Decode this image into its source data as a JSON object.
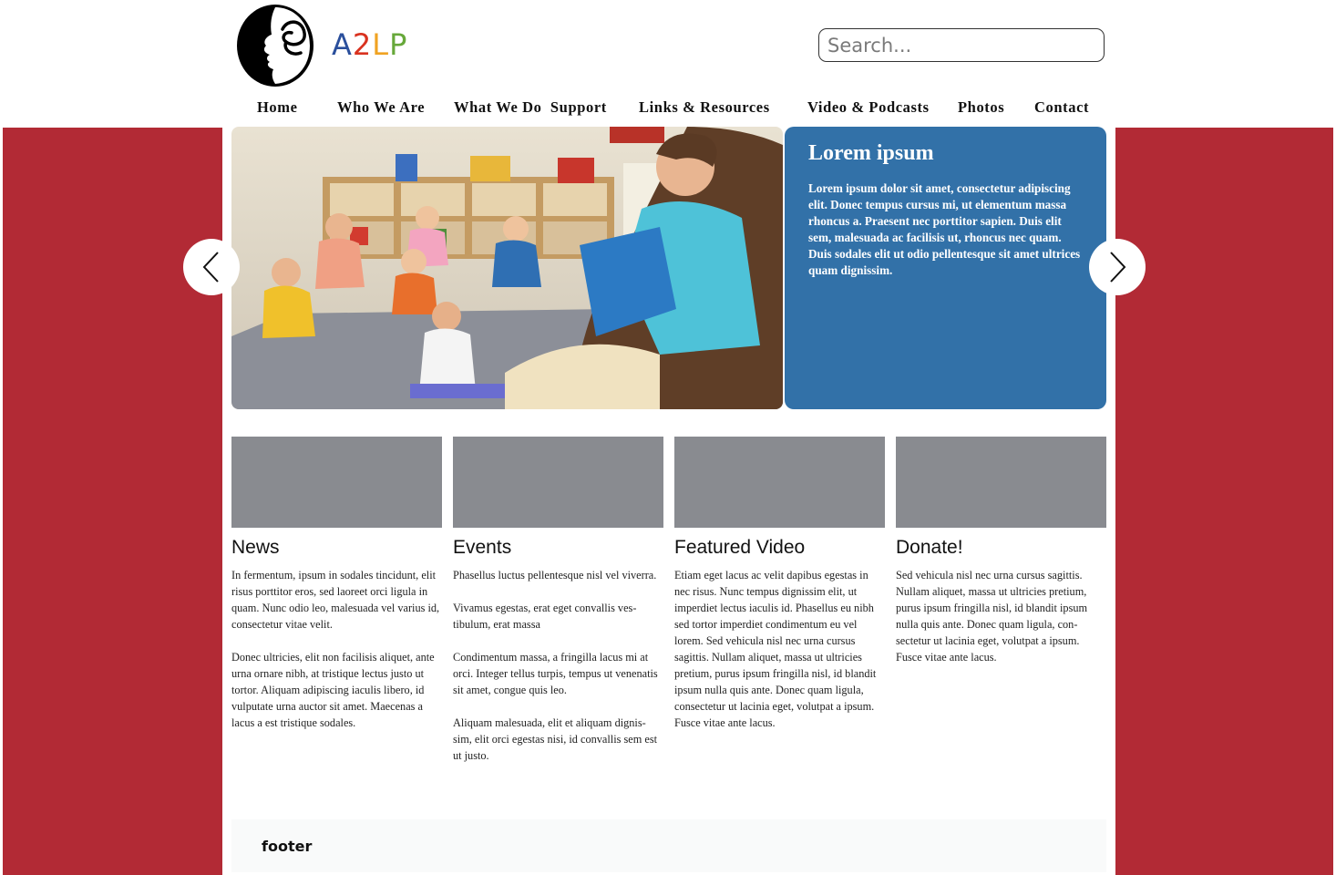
{
  "header": {
    "brand": {
      "letters": [
        "A",
        "2",
        "L",
        "P"
      ],
      "colors": [
        "#2a4f9c",
        "#d9321f",
        "#f0a322",
        "#67a83a"
      ]
    },
    "search": {
      "placeholder": "Search..."
    }
  },
  "nav": {
    "items": [
      {
        "label": "Home"
      },
      {
        "label": "Who We Are"
      },
      {
        "label": "What We Do  Support"
      },
      {
        "label": "Links & Resources"
      },
      {
        "label": "Video & Podcasts"
      },
      {
        "label": "Photos"
      },
      {
        "label": "Contact"
      }
    ]
  },
  "hero": {
    "title": "Lorem ipsum",
    "text": "Lorem ipsum dolor sit amet, consectetur adipiscing elit. Donec tempus cursus mi, ut elementum massa rhoncus a. Praesent nec porttitor sapien. Duis elit sem, malesuada ac facilisis ut, rhoncus nec quam. Duis sodales elit ut odio pellentesque sit amet ultrices quam dignissim.",
    "accent": "#3271a8"
  },
  "columns": [
    {
      "title": "News",
      "paragraphs": [
        "In fermentum, ipsum in sodales tincidunt, elit risus porttitor eros, sed laoreet orci ligula in quam. Nunc odio leo, malesuada vel varius id, consectetur vitae velit.",
        "Donec ultricies, elit non facilisis aliquet, ante urna ornare nibh, at tristique lectus justo ut tortor. Aliquam adipiscing iaculis libero, id vulputate urna auctor sit amet. Maecenas a lacus a est tristique sodales."
      ]
    },
    {
      "title": "Events",
      "paragraphs": [
        "Phasellus luctus pellentesque nisl vel viverra.",
        "Vivamus egestas, erat eget convallis ves-tibulum, erat massa",
        "Condimentum massa, a fringilla lacus mi at orci. Integer tellus turpis, tempus ut venenatis sit amet, congue quis leo.",
        "Aliquam malesuada, elit et aliquam dignis-sim, elit orci egestas nisi, id convallis sem est ut justo."
      ]
    },
    {
      "title": "Featured Video",
      "paragraphs": [
        "Etiam eget lacus ac velit dapibus egestas in nec risus. Nunc tempus dignissim elit, ut imperdiet lectus iaculis id. Phasellus eu nibh sed tortor imperdiet condimentum eu vel lorem. Sed vehicula nisl nec urna cursus sagittis. Nullam aliquet, massa ut ultricies pretium, purus ipsum fringilla nisl, id blandit ipsum nulla quis ante. Donec quam ligula, consectetur ut lacinia eget, volutpat a ipsum. Fusce vitae ante lacus."
      ]
    },
    {
      "title": "Donate!",
      "paragraphs": [
        "Sed vehicula nisl nec urna cursus sagittis. Nullam aliquet, massa ut ultricies pretium, purus ipsum fringilla nisl, id blandit ipsum nulla quis ante. Donec quam ligula, con-sectetur ut lacinia eget, volutpat a ipsum. Fusce vitae ante lacus."
      ]
    }
  ],
  "footer": {
    "label": "footer"
  },
  "colors": {
    "band": "#b22a35",
    "thumb": "#898b90"
  }
}
